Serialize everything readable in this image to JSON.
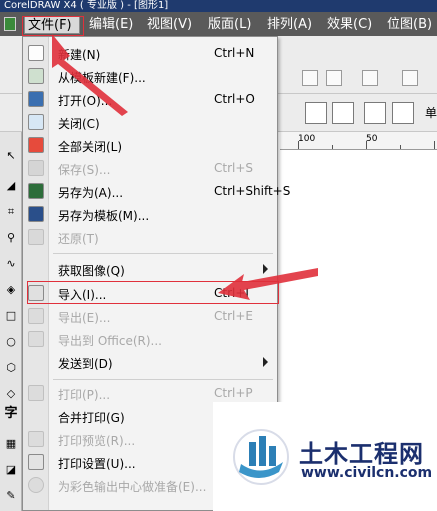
{
  "window": {
    "title": "CorelDRAW X4 ( 专业版 ) - [图形1]"
  },
  "menubar": {
    "items": [
      {
        "label": "文件(F)"
      },
      {
        "label": "编辑(E)"
      },
      {
        "label": "视图(V)"
      },
      {
        "label": "版面(L)"
      },
      {
        "label": "排列(A)"
      },
      {
        "label": "效果(C)"
      },
      {
        "label": "位图(B)"
      }
    ]
  },
  "file_menu": {
    "items": [
      {
        "label": "新建(N)",
        "shortcut": "Ctrl+N",
        "enabled": true
      },
      {
        "label": "从模板新建(F)...",
        "shortcut": "",
        "enabled": true
      },
      {
        "label": "打开(O)...",
        "shortcut": "Ctrl+O",
        "enabled": true
      },
      {
        "label": "关闭(C)",
        "shortcut": "",
        "enabled": true
      },
      {
        "label": "全部关闭(L)",
        "shortcut": "",
        "enabled": true
      },
      {
        "label": "保存(S)...",
        "shortcut": "Ctrl+S",
        "enabled": false
      },
      {
        "label": "另存为(A)...",
        "shortcut": "Ctrl+Shift+S",
        "enabled": true
      },
      {
        "label": "另存为模板(M)...",
        "shortcut": "",
        "enabled": true
      },
      {
        "label": "还原(T)",
        "shortcut": "",
        "enabled": false
      },
      {
        "label": "获取图像(Q)",
        "shortcut": "",
        "enabled": true,
        "submenu": true
      },
      {
        "label": "导入(I)...",
        "shortcut": "Ctrl+I",
        "enabled": true
      },
      {
        "label": "导出(E)...",
        "shortcut": "Ctrl+E",
        "enabled": false
      },
      {
        "label": "导出到 Office(R)...",
        "shortcut": "",
        "enabled": false
      },
      {
        "label": "发送到(D)",
        "shortcut": "",
        "enabled": true,
        "submenu": true
      },
      {
        "label": "打印(P)...",
        "shortcut": "Ctrl+P",
        "enabled": false
      },
      {
        "label": "合并打印(G)",
        "shortcut": "",
        "enabled": true
      },
      {
        "label": "打印预览(R)...",
        "shortcut": "",
        "enabled": false
      },
      {
        "label": "打印设置(U)...",
        "shortcut": "",
        "enabled": true
      },
      {
        "label": "为彩色输出中心做准备(E)...",
        "shortcut": "",
        "enabled": false
      }
    ]
  },
  "property_bar": {
    "label": "单"
  },
  "ruler": {
    "ticks": [
      "100",
      "50"
    ]
  },
  "toolbox": {
    "text_tool": "字"
  },
  "watermark": {
    "title": "土木工程网",
    "url": "www.civilcn.com"
  },
  "colors": {
    "highlight": "#e0303b",
    "menubar": "#5a5a5a",
    "brand": "#1b2f6e"
  }
}
